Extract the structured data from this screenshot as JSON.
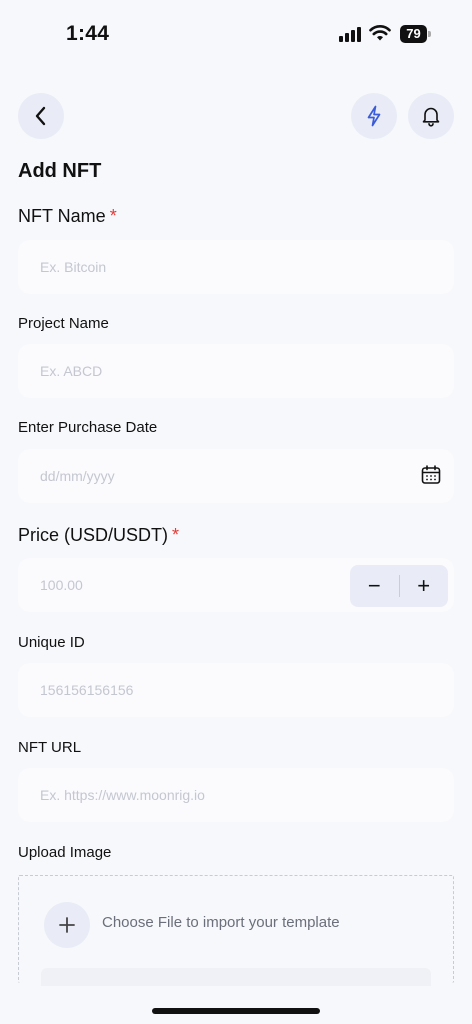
{
  "status_bar": {
    "time": "1:44",
    "battery": "79"
  },
  "header": {
    "back_icon": "chevron-left-icon",
    "flash_icon": "lightning-icon",
    "bell_icon": "bell-icon"
  },
  "page_title": "Add NFT",
  "form": {
    "nft_name": {
      "label": "NFT Name",
      "required": "*",
      "placeholder": "Ex. Bitcoin",
      "value": ""
    },
    "project_name": {
      "label": "Project Name",
      "placeholder": "Ex. ABCD",
      "value": ""
    },
    "purchase_date": {
      "label": "Enter Purchase Date",
      "placeholder": "dd/mm/yyyy",
      "value": "",
      "icon": "calendar-icon"
    },
    "price": {
      "label": "Price (USD/USDT)",
      "required": "*",
      "placeholder": "100.00",
      "value": "",
      "minus": "−",
      "plus": "+"
    },
    "unique_id": {
      "label": "Unique ID",
      "placeholder": "156156156156",
      "value": ""
    },
    "nft_url": {
      "label": "NFT URL",
      "placeholder": "Ex. https://www.moonrig.io",
      "value": ""
    },
    "upload": {
      "label": "Upload Image",
      "prompt": "Choose File to import your template",
      "icon": "plus-icon"
    }
  },
  "colors": {
    "background": "#f7f8fb",
    "button_bg": "#e9ecf6",
    "required": "#e53935",
    "accent_icon": "#3b5bdb"
  }
}
